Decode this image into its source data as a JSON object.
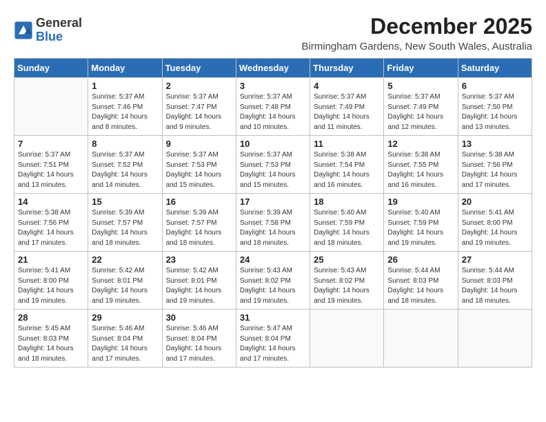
{
  "logo": {
    "general": "General",
    "blue": "Blue"
  },
  "title": "December 2025",
  "location": "Birmingham Gardens, New South Wales, Australia",
  "days_header": [
    "Sunday",
    "Monday",
    "Tuesday",
    "Wednesday",
    "Thursday",
    "Friday",
    "Saturday"
  ],
  "weeks": [
    [
      {
        "day": "",
        "info": ""
      },
      {
        "day": "1",
        "info": "Sunrise: 5:37 AM\nSunset: 7:46 PM\nDaylight: 14 hours\nand 8 minutes."
      },
      {
        "day": "2",
        "info": "Sunrise: 5:37 AM\nSunset: 7:47 PM\nDaylight: 14 hours\nand 9 minutes."
      },
      {
        "day": "3",
        "info": "Sunrise: 5:37 AM\nSunset: 7:48 PM\nDaylight: 14 hours\nand 10 minutes."
      },
      {
        "day": "4",
        "info": "Sunrise: 5:37 AM\nSunset: 7:49 PM\nDaylight: 14 hours\nand 11 minutes."
      },
      {
        "day": "5",
        "info": "Sunrise: 5:37 AM\nSunset: 7:49 PM\nDaylight: 14 hours\nand 12 minutes."
      },
      {
        "day": "6",
        "info": "Sunrise: 5:37 AM\nSunset: 7:50 PM\nDaylight: 14 hours\nand 13 minutes."
      }
    ],
    [
      {
        "day": "7",
        "info": "Sunrise: 5:37 AM\nSunset: 7:51 PM\nDaylight: 14 hours\nand 13 minutes."
      },
      {
        "day": "8",
        "info": "Sunrise: 5:37 AM\nSunset: 7:52 PM\nDaylight: 14 hours\nand 14 minutes."
      },
      {
        "day": "9",
        "info": "Sunrise: 5:37 AM\nSunset: 7:53 PM\nDaylight: 14 hours\nand 15 minutes."
      },
      {
        "day": "10",
        "info": "Sunrise: 5:37 AM\nSunset: 7:53 PM\nDaylight: 14 hours\nand 15 minutes."
      },
      {
        "day": "11",
        "info": "Sunrise: 5:38 AM\nSunset: 7:54 PM\nDaylight: 14 hours\nand 16 minutes."
      },
      {
        "day": "12",
        "info": "Sunrise: 5:38 AM\nSunset: 7:55 PM\nDaylight: 14 hours\nand 16 minutes."
      },
      {
        "day": "13",
        "info": "Sunrise: 5:38 AM\nSunset: 7:56 PM\nDaylight: 14 hours\nand 17 minutes."
      }
    ],
    [
      {
        "day": "14",
        "info": "Sunrise: 5:38 AM\nSunset: 7:56 PM\nDaylight: 14 hours\nand 17 minutes."
      },
      {
        "day": "15",
        "info": "Sunrise: 5:39 AM\nSunset: 7:57 PM\nDaylight: 14 hours\nand 18 minutes."
      },
      {
        "day": "16",
        "info": "Sunrise: 5:39 AM\nSunset: 7:57 PM\nDaylight: 14 hours\nand 18 minutes."
      },
      {
        "day": "17",
        "info": "Sunrise: 5:39 AM\nSunset: 7:58 PM\nDaylight: 14 hours\nand 18 minutes."
      },
      {
        "day": "18",
        "info": "Sunrise: 5:40 AM\nSunset: 7:59 PM\nDaylight: 14 hours\nand 18 minutes."
      },
      {
        "day": "19",
        "info": "Sunrise: 5:40 AM\nSunset: 7:59 PM\nDaylight: 14 hours\nand 19 minutes."
      },
      {
        "day": "20",
        "info": "Sunrise: 5:41 AM\nSunset: 8:00 PM\nDaylight: 14 hours\nand 19 minutes."
      }
    ],
    [
      {
        "day": "21",
        "info": "Sunrise: 5:41 AM\nSunset: 8:00 PM\nDaylight: 14 hours\nand 19 minutes."
      },
      {
        "day": "22",
        "info": "Sunrise: 5:42 AM\nSunset: 8:01 PM\nDaylight: 14 hours\nand 19 minutes."
      },
      {
        "day": "23",
        "info": "Sunrise: 5:42 AM\nSunset: 8:01 PM\nDaylight: 14 hours\nand 19 minutes."
      },
      {
        "day": "24",
        "info": "Sunrise: 5:43 AM\nSunset: 8:02 PM\nDaylight: 14 hours\nand 19 minutes."
      },
      {
        "day": "25",
        "info": "Sunrise: 5:43 AM\nSunset: 8:02 PM\nDaylight: 14 hours\nand 19 minutes."
      },
      {
        "day": "26",
        "info": "Sunrise: 5:44 AM\nSunset: 8:03 PM\nDaylight: 14 hours\nand 18 minutes."
      },
      {
        "day": "27",
        "info": "Sunrise: 5:44 AM\nSunset: 8:03 PM\nDaylight: 14 hours\nand 18 minutes."
      }
    ],
    [
      {
        "day": "28",
        "info": "Sunrise: 5:45 AM\nSunset: 8:03 PM\nDaylight: 14 hours\nand 18 minutes."
      },
      {
        "day": "29",
        "info": "Sunrise: 5:46 AM\nSunset: 8:04 PM\nDaylight: 14 hours\nand 17 minutes."
      },
      {
        "day": "30",
        "info": "Sunrise: 5:46 AM\nSunset: 8:04 PM\nDaylight: 14 hours\nand 17 minutes."
      },
      {
        "day": "31",
        "info": "Sunrise: 5:47 AM\nSunset: 8:04 PM\nDaylight: 14 hours\nand 17 minutes."
      },
      {
        "day": "",
        "info": ""
      },
      {
        "day": "",
        "info": ""
      },
      {
        "day": "",
        "info": ""
      }
    ]
  ]
}
